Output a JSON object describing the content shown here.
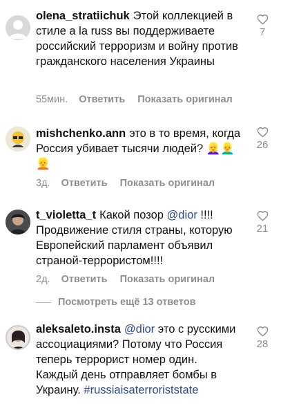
{
  "comments": [
    {
      "username": "olena_stratiichuk",
      "text": "Этой коллекцией в стиле a la russ вы поддерживаете российский терроризм и войну против гражданского населения Украины",
      "time": "55мин.",
      "reply_label": "Ответить",
      "original_label": "Показать оригинал",
      "likes": "7"
    },
    {
      "username": "mishchenko.ann",
      "text_before": "это в то время, когда Россия убивает тысячи людей?",
      "text_emoji": "👱‍♀️👱‍♂️👱",
      "time": "3д.",
      "reply_label": "Ответить",
      "original_label": "Показать оригинал",
      "likes": "26"
    },
    {
      "username": "t_violetta_t",
      "text_before": "Какой позор",
      "mention": "@dior",
      "text_after": "!!!! Продвижение стиля страны, которую Европейский парламент объявил страной-террористом!!!!",
      "time": "2д.",
      "reply_label": "Ответить",
      "original_label": "Показать оригинал",
      "likes": "21"
    },
    {
      "username": "aleksaleto.insta",
      "mention": "@dior",
      "text_after": "это с русскими ассоциациями? Потому что Россия теперь террорист номер один. Каждый день отправляет бомбы в Украину.",
      "hashtag": "#russiaisaterroriststate",
      "likes": "28"
    }
  ],
  "view_replies_label": "Посмотреть ещё 13 ответов",
  "colors": {
    "text": "#111111",
    "muted": "#8e8e8e",
    "link": "#2b4a8c"
  },
  "icons": {
    "like": "heart-outline-icon"
  }
}
